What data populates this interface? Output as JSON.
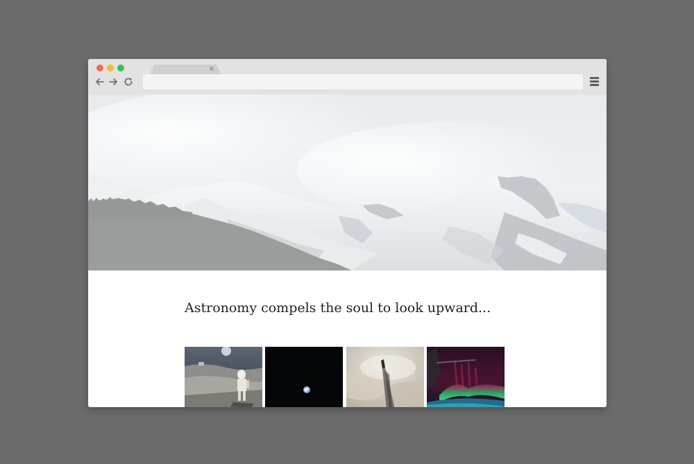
{
  "browser": {
    "tab": {
      "title": "",
      "close_glyph": "×"
    },
    "address_bar": {
      "value": "",
      "placeholder": ""
    },
    "controls": {
      "back_icon": "arrow-left-icon",
      "forward_icon": "arrow-right-icon",
      "reload_icon": "reload-icon",
      "menu_icon": "hamburger-menu-icon"
    },
    "traffic_lights": {
      "close": "#f26b4f",
      "minimize": "#f0bf2c",
      "maximize": "#39c24a"
    }
  },
  "page": {
    "hero_image": "snowy-mountain-range",
    "headline": "Astronomy compels the soul to look upward...",
    "gallery": [
      {
        "image": "astronaut-on-moon"
      },
      {
        "image": "earth-in-space"
      },
      {
        "image": "shuttle-launch-through-clouds"
      },
      {
        "image": "aurora-from-orbit"
      }
    ]
  },
  "colors": {
    "desktop_background": "#6b6b6b",
    "browser_chrome": "#e2e2e2",
    "page_background": "#ffffff",
    "text": "#222222"
  }
}
